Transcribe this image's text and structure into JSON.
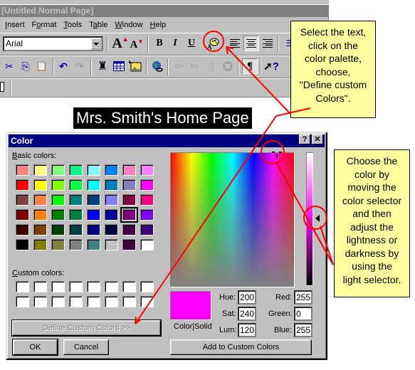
{
  "app": {
    "title": "[Untitled Normal Page]",
    "menu": [
      {
        "label": "Insert",
        "accel": "I"
      },
      {
        "label": "Format",
        "accel": "o"
      },
      {
        "label": "Tools",
        "accel": "T"
      },
      {
        "label": "Table",
        "accel": "a"
      },
      {
        "label": "Window",
        "accel": "W"
      },
      {
        "label": "Help",
        "accel": "H"
      }
    ],
    "font_value": "Arial",
    "toolbar1": {
      "grow_font": "A",
      "shrink_font": "A",
      "bold": "B",
      "italic": "I",
      "underline": "U",
      "text_color_icon": "palette-icon"
    },
    "toolbar2": {
      "cut": "✂",
      "copy": "⎘",
      "paste": "📋",
      "undo": "↶",
      "redo": "↷",
      "back": "⇦",
      "forward": "⇨",
      "show_all": "¶",
      "help": "?"
    }
  },
  "heading": "Mrs. Smith's Home Page",
  "dialog": {
    "title": "Color",
    "help_btn": "?",
    "close_btn": "✕",
    "basic_label_accel": "B",
    "basic_label_rest": "asic colors:",
    "basic_colors": [
      "#ff8080",
      "#ffff80",
      "#80ff80",
      "#00ff80",
      "#80ffff",
      "#0080ff",
      "#ff80c0",
      "#ff80ff",
      "#ff0000",
      "#ffff00",
      "#80ff00",
      "#00ff40",
      "#00ffff",
      "#0080c0",
      "#8080c0",
      "#ff00ff",
      "#804040",
      "#ff8040",
      "#00ff00",
      "#008080",
      "#004080",
      "#8080ff",
      "#800040",
      "#ff0080",
      "#800000",
      "#ff8000",
      "#008000",
      "#008040",
      "#0000ff",
      "#0000a0",
      "#800080",
      "#8000ff",
      "#400000",
      "#804000",
      "#004000",
      "#004040",
      "#000080",
      "#000040",
      "#400040",
      "#400080",
      "#000000",
      "#808000",
      "#808040",
      "#808080",
      "#408080",
      "#c0c0c0",
      "#400040",
      "#ffffff"
    ],
    "selected_basic_index": 30,
    "custom_label_accel": "C",
    "custom_label_rest": "ustom colors:",
    "custom_colors": [
      "#ffffff",
      "#ffffff",
      "#ffffff",
      "#ffffff",
      "#ffffff",
      "#ffffff",
      "#ffffff",
      "#ffffff",
      "#ffffff",
      "#ffffff",
      "#ffffff",
      "#ffffff",
      "#ffffff",
      "#ffffff",
      "#ffffff",
      "#ffffff"
    ],
    "define_custom_btn": "Define Custom Colors >>",
    "ok_btn": "OK",
    "cancel_btn": "Cancel",
    "color_solid_label": "Color|Solid",
    "current_color": "#ff00ff",
    "fields": {
      "hue": {
        "label": "Hue:",
        "value": "200"
      },
      "sat": {
        "label": "Sat:",
        "value": "240"
      },
      "lum": {
        "label": "Lum:",
        "value": "120"
      },
      "red": {
        "label": "Red:",
        "value": "255"
      },
      "green": {
        "label": "Green:",
        "value": "0"
      },
      "blue": {
        "label": "Blue:",
        "value": "255"
      }
    },
    "add_custom_btn": "Add to Custom Colors"
  },
  "callouts": {
    "palette_tip": [
      "Select the text,",
      "click on the",
      "color palette,",
      "choose,",
      "\"Define custom",
      "Colors\"."
    ],
    "selector_tip": [
      "Choose the",
      "color by",
      "moving the",
      "color selector",
      "and then",
      "adjust the",
      "lightness or",
      "darkness by",
      "using the",
      "light selector."
    ]
  },
  "annotation_color": "#ff0000"
}
